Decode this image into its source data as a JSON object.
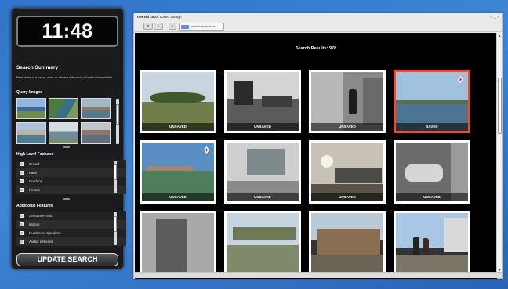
{
  "clock": "11:48",
  "summary": {
    "title": "Search Summary",
    "description": "Find shots of a canal, river, or stream with some of both banks visible"
  },
  "query_images": {
    "title": "Query Images"
  },
  "high_level_features": {
    "title": "High Level Features",
    "items": [
      "Crowd",
      "Face",
      "Outdoor",
      "Person"
    ]
  },
  "additional_features": {
    "title": "Additional Features",
    "items": [
      "On-screen text",
      "Motion",
      "Number of speakers",
      "Audio: vehicles"
    ]
  },
  "update_button": "UPDATE SEARCH",
  "window": {
    "title": "TrecVid 2007:",
    "user": "/User: daragh",
    "tab_label": "search.show.done",
    "controls": "□ _ ×"
  },
  "toolbar": {
    "zoom_icon": "magnifier-icon",
    "back_icon": "back-icon",
    "forward_icon": "forward-icon"
  },
  "results": {
    "title": "Search Results: 978",
    "cards": [
      {
        "label": "UNSAVED",
        "saved": false,
        "badge": false
      },
      {
        "label": "UNSAVED",
        "saved": false,
        "badge": false
      },
      {
        "label": "UNSAVED",
        "saved": false,
        "badge": false
      },
      {
        "label": "SAVED",
        "saved": true,
        "badge": true
      },
      {
        "label": "UNSAVED",
        "saved": false,
        "badge": true
      },
      {
        "label": "UNSAVED",
        "saved": false,
        "badge": false
      },
      {
        "label": "UNSAVED",
        "saved": false,
        "badge": false
      },
      {
        "label": "UNSAVED",
        "saved": false,
        "badge": false
      },
      {
        "label": "",
        "saved": false,
        "badge": false
      },
      {
        "label": "",
        "saved": false,
        "badge": false
      },
      {
        "label": "",
        "saved": false,
        "badge": false
      },
      {
        "label": "",
        "saved": false,
        "badge": false
      }
    ]
  },
  "colors": {
    "desktop": "#3a7fd0",
    "saved_border": "#e84d2e",
    "panel": "#1b1b1d"
  }
}
